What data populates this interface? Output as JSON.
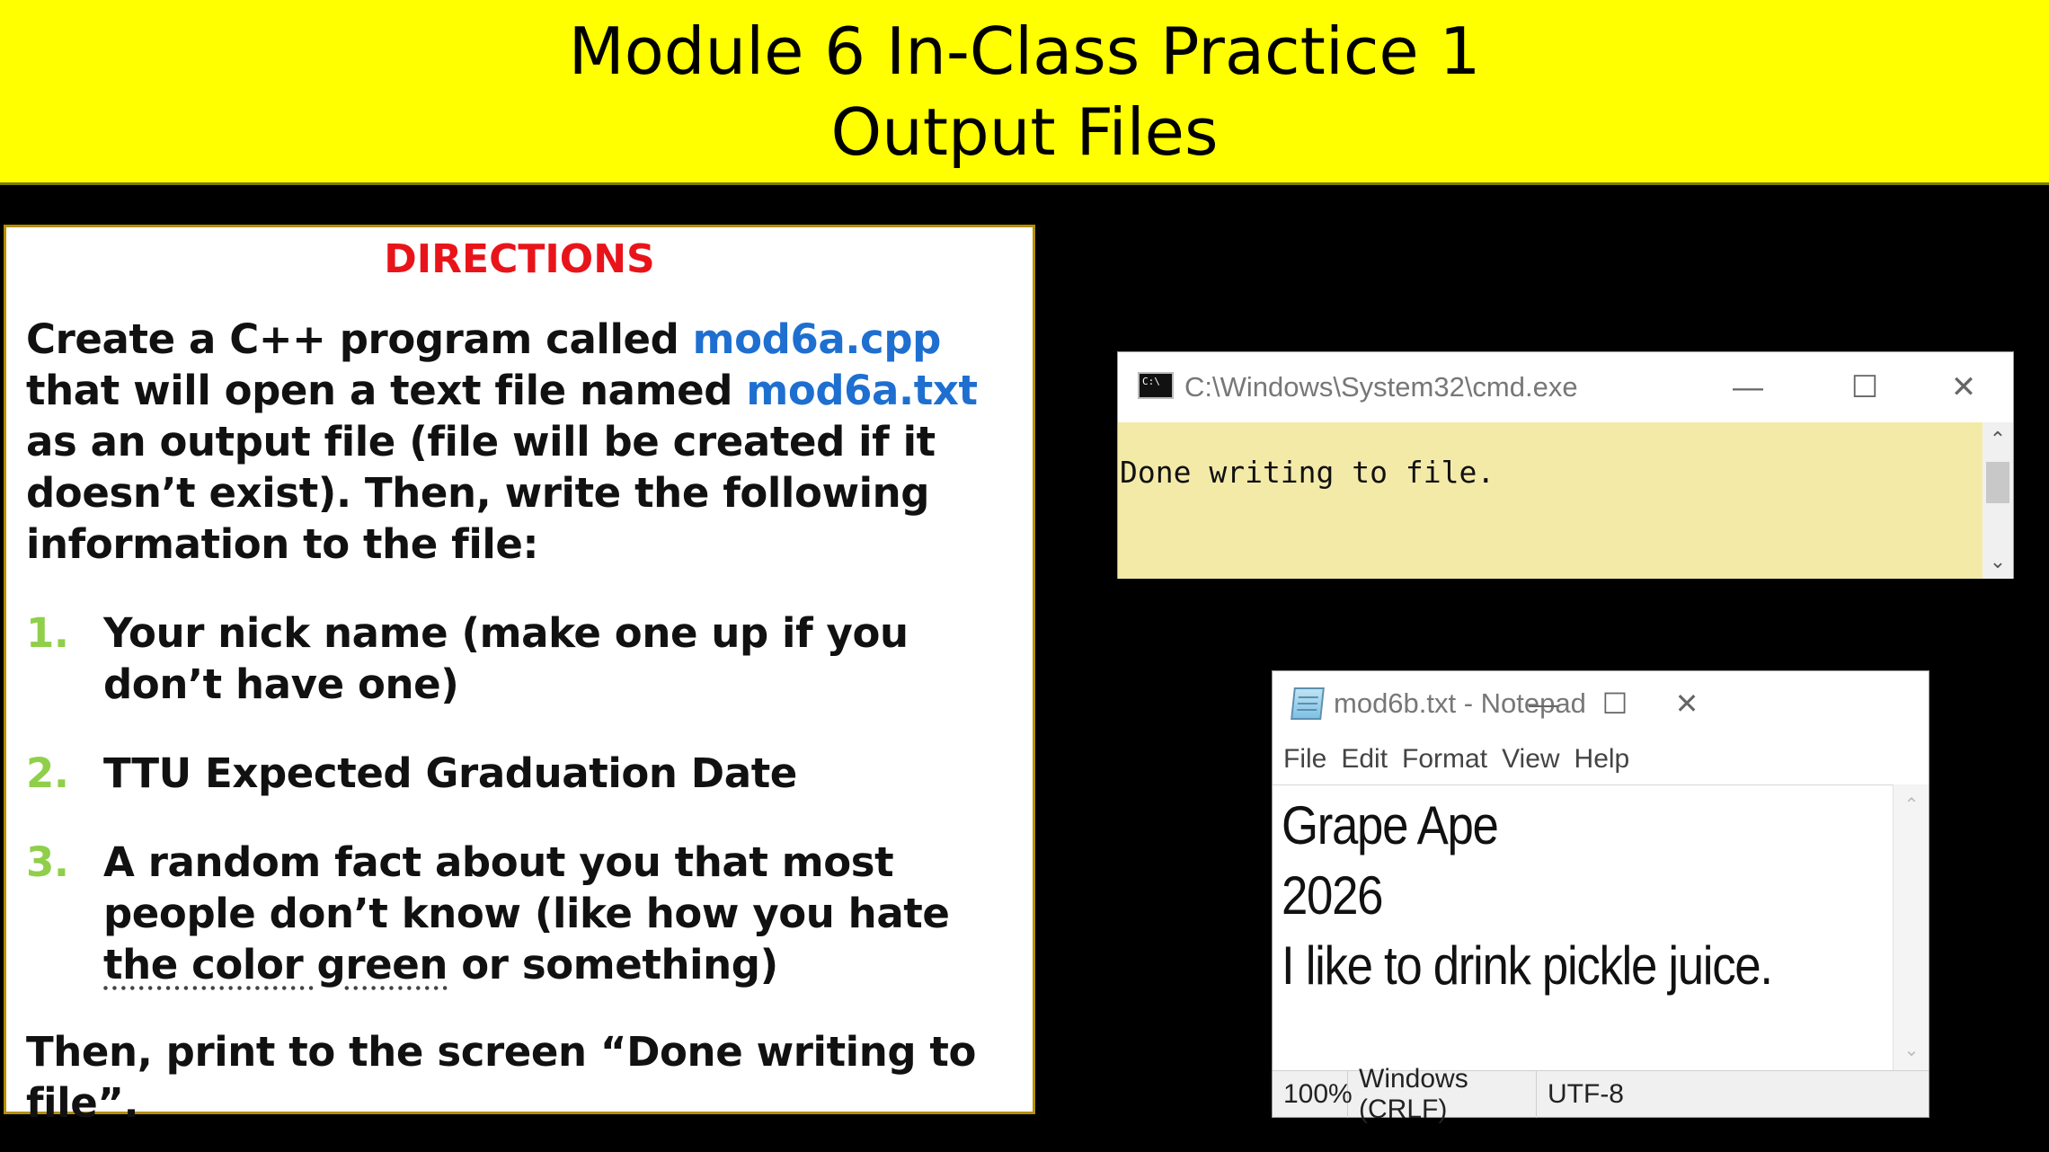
{
  "slide": {
    "title_line1": "Module 6 In-Class Practice 1",
    "title_line2": "Output Files"
  },
  "directions": {
    "heading": "DIRECTIONS",
    "intro_1": "Create a C++ program called ",
    "program_file": "mod6a.cpp",
    "intro_2": " that will open a text file named ",
    "text_file": "mod6a.txt",
    "intro_3": "  as an output file (file will be created if it doesn’t exist).  Then, write the following information to the file:",
    "items": [
      {
        "number": "1.",
        "text": "Your nick name (make one up if you don’t have one)"
      },
      {
        "number": "2.",
        "text": "TTU Expected Graduation Date"
      },
      {
        "number": "3.",
        "text_a": "A random fact about you that most people don’t know (like how you hate ",
        "text_b": "the color green",
        "text_c": " or something)"
      }
    ],
    "outro": "Then, print to the screen “Done writing to file”."
  },
  "cmd_window": {
    "title": "C:\\Windows\\System32\\cmd.exe",
    "output": "Done writing to file.",
    "icon": "console-icon"
  },
  "notepad_window": {
    "title": "mod6b.txt - Notepad",
    "menu": [
      "File",
      "Edit",
      "Format",
      "View",
      "Help"
    ],
    "lines": [
      "Grape Ape",
      "2026",
      "I like to drink pickle juice."
    ],
    "status": {
      "zoom": "100%",
      "line_ending": "Windows (CRLF)",
      "encoding": "UTF-8"
    },
    "icon": "notepad-icon"
  },
  "window_controls": {
    "minimize": "—",
    "maximize": "☐",
    "close": "✕"
  },
  "colors": {
    "banner": "#ffff00",
    "heading": "#e8141a",
    "filename": "#1e6fd0",
    "list_number": "#8fcf4a",
    "console_bg": "#f4eaa8"
  }
}
